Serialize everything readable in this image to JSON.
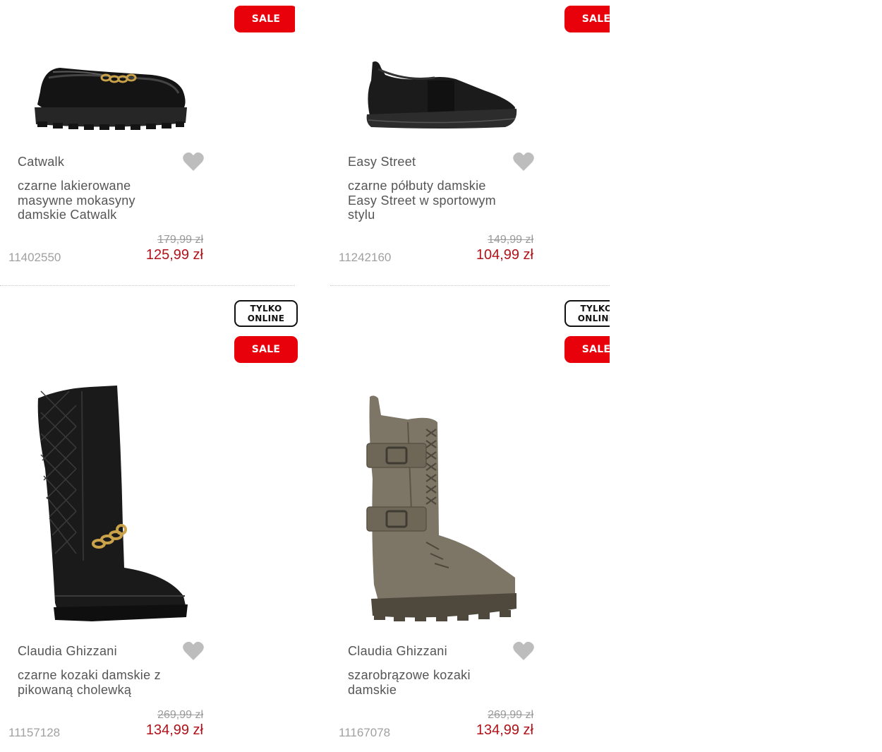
{
  "products": [
    {
      "brand": "Catwalk",
      "title": "czarne lakierowane masywne mokasyny damskie Catwalk",
      "old_price": "179,99 zł",
      "price": "125,99 zł",
      "sku": "11402550",
      "badges": [
        "SALE"
      ]
    },
    {
      "brand": "Easy Street",
      "title": "czarne półbuty damskie Easy Street w sportowym stylu",
      "old_price": "149,99 zł",
      "price": "104,99 zł",
      "sku": "11242160",
      "badges": [
        "SALE"
      ]
    },
    {
      "brand": "Claudia Ghizzani",
      "title": "czarne kozaki damskie z pikowaną cholewką",
      "old_price": "269,99 zł",
      "price": "134,99 zł",
      "sku": "11157128",
      "badges": [
        "TYLKO",
        "ONLINE",
        "SALE"
      ]
    },
    {
      "brand": "Claudia Ghizzani",
      "title": "szarobrązowe kozaki damskie",
      "old_price": "269,99 zł",
      "price": "134,99 zł",
      "sku": "11167078",
      "badges": [
        "TYLKO",
        "ONLINE",
        "SALE"
      ]
    }
  ],
  "icons": {
    "wishlist": "heart-icon"
  },
  "colors": {
    "sale_badge": "#e8000b",
    "price": "#b0121a",
    "old_price": "#9b9b9b",
    "heart": "#bdbdbd"
  }
}
